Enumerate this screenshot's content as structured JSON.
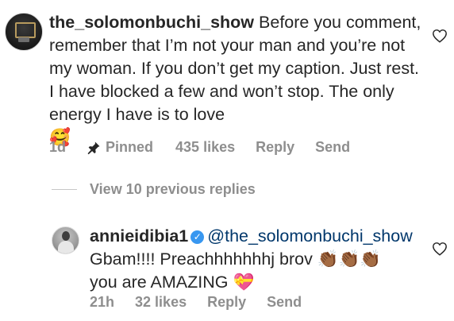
{
  "main_comment": {
    "username": "the_solomonbuchi_show",
    "text": "Before you comment, remember that I’m not your man and you’re not my woman. If you don’t get my caption. Just rest. I have blocked a few and won’t stop. The only energy I have is to love",
    "emoji": "🥰",
    "time": "1d",
    "pinned_label": "Pinned",
    "likes": "435 likes",
    "reply_label": "Reply",
    "send_label": "Send"
  },
  "view_replies": {
    "label": "View 10 previous replies"
  },
  "reply_comment": {
    "username": "annieidibia1",
    "mention": "@the_solomonbuchi_show",
    "text_line1": "Gbam!!!! Preachhhhhhhj brov",
    "emoji_clap": "👏🏾👏🏾👏🏾",
    "text_line2": "you are AMAZING",
    "emoji_heart": "💝",
    "time": "21h",
    "likes": "32 likes",
    "reply_label": "Reply",
    "send_label": "Send"
  },
  "colors": {
    "text": "#262626",
    "secondary": "#8e8e8e",
    "mention": "#00376b",
    "verified": "#3897f0"
  },
  "icons": {
    "pin": "pin-icon",
    "like": "heart-outline-icon",
    "verified": "verified-badge-icon"
  }
}
